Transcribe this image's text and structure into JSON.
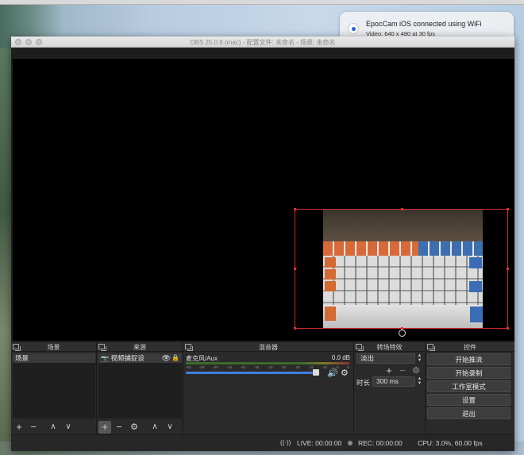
{
  "notification": {
    "title": "EpocCam iOS connected using WiFi",
    "body": "Video: 640 x 480 at 30 fps"
  },
  "window": {
    "title": "OBS 25.0.8 (mac) - 配置文件: 未命名 - 场景: 未命名"
  },
  "docks": {
    "scenes": {
      "title": "场景",
      "items": [
        "场景"
      ]
    },
    "sources": {
      "title": "来源",
      "items": [
        {
          "label": "视频捕捉设",
          "icon": "camera-icon"
        }
      ]
    },
    "mixer": {
      "title": "混音器",
      "channel": "麦克风/Aux",
      "level": "0.0 dB",
      "ticks": [
        "-60",
        "-55",
        "-50",
        "-45",
        "-40",
        "-35",
        "-30",
        "-25",
        "-20",
        "-15",
        "-10",
        "-5",
        "0"
      ],
      "fader_fraction": 0.95
    },
    "transitions": {
      "title": "转场特效",
      "selected": "淡出",
      "duration_label": "时长",
      "duration_value": "300 ms"
    },
    "controls": {
      "title": "控件",
      "start_streaming": "开始推流",
      "start_recording": "开始录制",
      "studio_mode": "工作室模式",
      "settings": "设置",
      "exit": "退出"
    }
  },
  "status": {
    "live": "LIVE: 00:00:00",
    "rec": "REC: 00:00:00",
    "cpu": "CPU: 3.0%, 60.00 fps"
  },
  "colors": {
    "selection_outline": "#d22a2a",
    "fader": "#3d7fe0",
    "panel_bg": "#2a2a2a"
  }
}
